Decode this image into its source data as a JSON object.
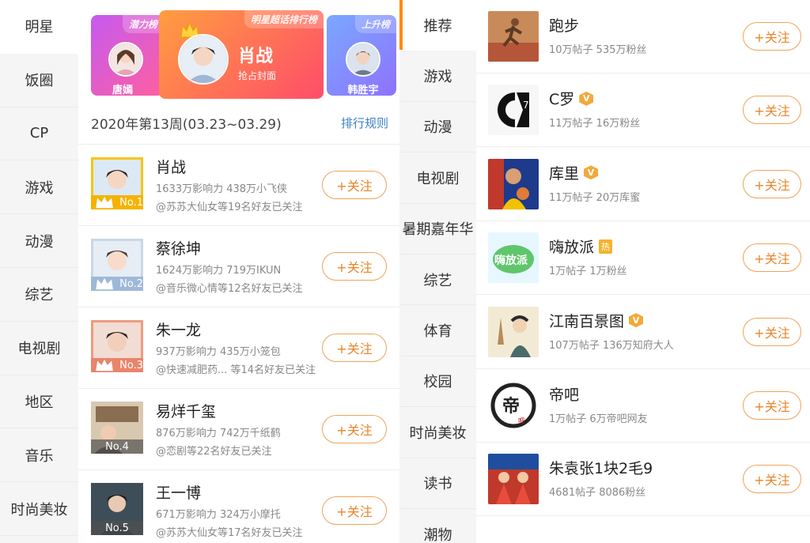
{
  "left_categories": [
    "明星",
    "饭圈",
    "CP",
    "游戏",
    "动漫",
    "综艺",
    "电视剧",
    "地区",
    "音乐",
    "时尚美妆"
  ],
  "banner": {
    "left": {
      "tag": "潜力榜",
      "name": "唐嫣"
    },
    "main": {
      "tag": "明星超话排行榜",
      "name": "肖战",
      "sub": "抢占封面"
    },
    "right": {
      "tag": "上升榜",
      "name": "韩胜宇"
    }
  },
  "week_label": "2020年第13周(03.23~03.29)",
  "rule_link": "排行规则",
  "follow_label": "+关注",
  "rankings": [
    {
      "rank": "No.1",
      "name": "肖战",
      "stats": "1633万影响力 438万小飞侠",
      "friends": "@苏苏大仙女等19名好友已关注",
      "badge_color": "#f5b300",
      "frame_color": "#f5c518"
    },
    {
      "rank": "No.2",
      "name": "蔡徐坤",
      "stats": "1624万影响力 719万IKUN",
      "friends": "@音乐微心情等12名好友已关注",
      "badge_color": "#9fb8d8",
      "frame_color": "#c9d7e8"
    },
    {
      "rank": "No.3",
      "name": "朱一龙",
      "stats": "937万影响力 435万小笼包",
      "friends": "@快速减肥药...  等14名好友已关注",
      "badge_color": "#e8856a",
      "frame_color": "#f09a80"
    },
    {
      "rank": "No.4",
      "name": "易烊千玺",
      "stats": "876万影响力 742万千纸鹤",
      "friends": "@恋剧等22名好友已关注",
      "badge_color": "rgba(80,80,80,0.7)",
      "frame_color": "#eeeeee"
    },
    {
      "rank": "No.5",
      "name": "王一博",
      "stats": "671万影响力 324万小摩托",
      "friends": "@苏苏大仙女等17名好友已关注",
      "badge_color": "rgba(80,80,80,0.7)",
      "frame_color": "#eeeeee"
    }
  ],
  "right_categories": [
    "推荐",
    "游戏",
    "动漫",
    "电视剧",
    "暑期嘉年华",
    "综艺",
    "体育",
    "校园",
    "时尚美妆",
    "读书",
    "潮物"
  ],
  "topics": [
    {
      "name": "跑步",
      "stats": "10万帖子 535万粉丝",
      "badge": "",
      "icon": "runner-image"
    },
    {
      "name": "C罗",
      "stats": "11万帖子 16万粉丝",
      "badge": "V",
      "icon": "cr7-logo"
    },
    {
      "name": "库里",
      "stats": "11万帖子 20万库蜜",
      "badge": "V",
      "icon": "curry-image"
    },
    {
      "name": "嗨放派",
      "stats": "1万帖子 1万粉丝",
      "badge": "热",
      "icon": "haifangpai-logo"
    },
    {
      "name": "江南百景图",
      "stats": "107万帖子 136万知府大人",
      "badge": "V",
      "icon": "jiangnan-image"
    },
    {
      "name": "帝吧",
      "stats": "1万帖子 6万帝吧网友",
      "badge": "",
      "icon": "diba-logo"
    },
    {
      "name": "朱袁张1块2毛9",
      "stats": "4681帖子 8086粉丝",
      "badge": "",
      "icon": "volleyball-image"
    }
  ],
  "colors": {
    "accent": "#ff8a00",
    "follow": "#e8852a",
    "link": "#3b7fc4"
  }
}
